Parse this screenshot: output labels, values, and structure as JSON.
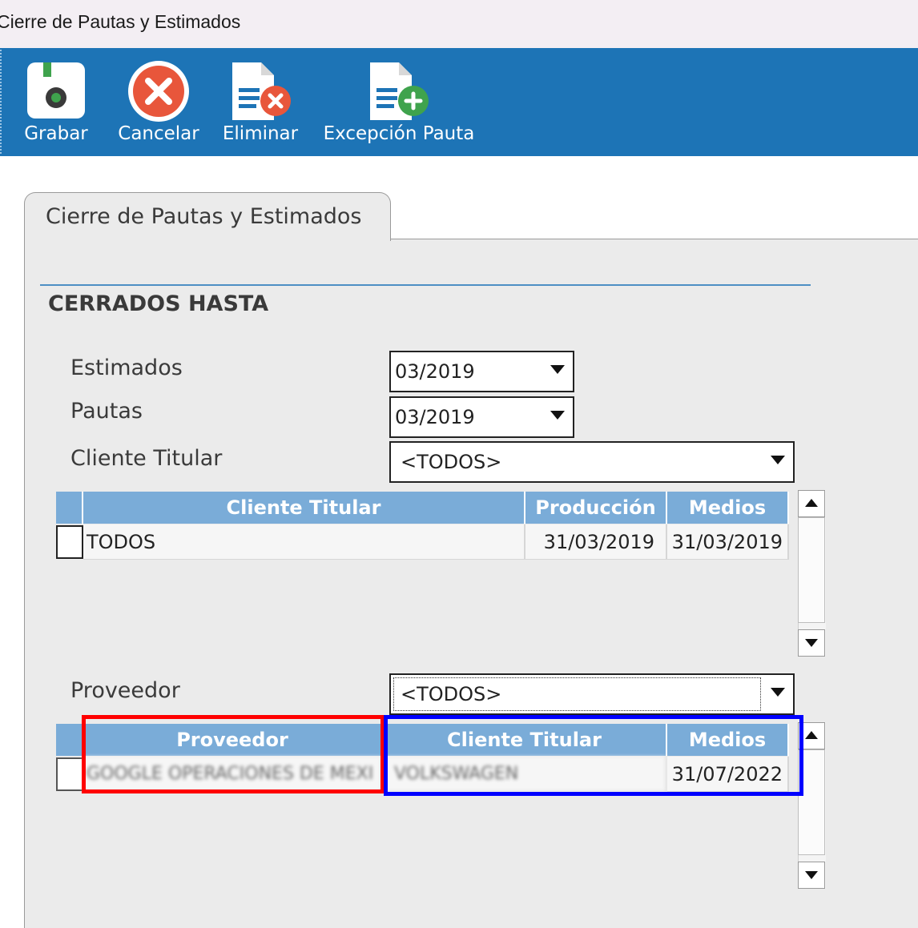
{
  "window": {
    "title": "Cierre de Pautas y Estimados"
  },
  "toolbar": {
    "save_label": "Grabar",
    "cancel_label": "Cancelar",
    "delete_label": "Eliminar",
    "exception_label": "Excepción Pauta"
  },
  "tab": {
    "label": "Cierre de Pautas y Estimados"
  },
  "section": {
    "title": "CERRADOS HASTA"
  },
  "fields": {
    "estimados_label": "Estimados",
    "estimados_value": "03/2019",
    "pautas_label": "Pautas",
    "pautas_value": "03/2019",
    "cliente_label": "Cliente Titular",
    "cliente_value": "<TODOS>",
    "proveedor_label": "Proveedor",
    "proveedor_value": "<TODOS>"
  },
  "grid1": {
    "headers": [
      "Cliente Titular",
      "Producción",
      "Medios"
    ],
    "rows": [
      {
        "cliente": "TODOS",
        "produccion": "31/03/2019",
        "medios": "31/03/2019"
      }
    ]
  },
  "grid2": {
    "headers": [
      "Proveedor",
      "Cliente Titular",
      "Medios"
    ],
    "rows": [
      {
        "proveedor": "GOOGLE OPERACIONES DE MEXI",
        "cliente": "VOLKSWAGEN",
        "medios": "31/07/2022"
      }
    ]
  },
  "colors": {
    "toolbar_bg": "#1d74b6",
    "grid_header_bg": "#7aacd8",
    "highlight_red": "#ff0000",
    "highlight_blue": "#0000ff"
  },
  "icons": [
    "save-icon",
    "cancel-icon",
    "delete-document-icon",
    "add-document-icon"
  ]
}
